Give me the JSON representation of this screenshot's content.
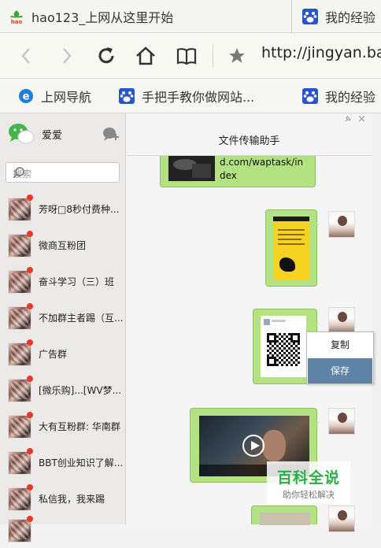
{
  "tabs": [
    {
      "title": "hao123_上网从这里开始",
      "icon": "hao123-icon"
    },
    {
      "title": "我的经验",
      "icon": "baidu-paw-icon"
    }
  ],
  "nav": {
    "url": "http://jingyan.ba"
  },
  "bookmarks": [
    {
      "label": "上网导航",
      "icon": "ie-icon"
    },
    {
      "label": "手把手教你做网站...",
      "icon": "baidu-paw-icon"
    },
    {
      "label": "我的经验",
      "icon": "baidu-paw-icon"
    }
  ],
  "sidebar": {
    "username": "爱爱",
    "search_placeholder": "搜索",
    "conversations": [
      {
        "name": "芳呀□8秒付费种..."
      },
      {
        "name": "微商互粉团"
      },
      {
        "name": "奋斗学习（三）班"
      },
      {
        "name": "不加群主者踢（互..."
      },
      {
        "name": "广告群"
      },
      {
        "name": "[微乐购]...[WV梦..."
      },
      {
        "name": "大有互粉群: 华南群"
      },
      {
        "name": "BBT创业知识了解..."
      },
      {
        "name": "私信我，我来踢"
      },
      {
        "name": ""
      }
    ]
  },
  "chat": {
    "title": "文件传输助手",
    "link_text": "d.com/waptask/index",
    "context_menu": {
      "copy": "复制",
      "save": "保存"
    }
  },
  "watermark": {
    "title": "百科全说",
    "subtitle": "助你轻松解决"
  },
  "colors": {
    "bubble": "#b2e281",
    "menu_highlight": "#5e83a5",
    "unread": "#e23b2e"
  }
}
